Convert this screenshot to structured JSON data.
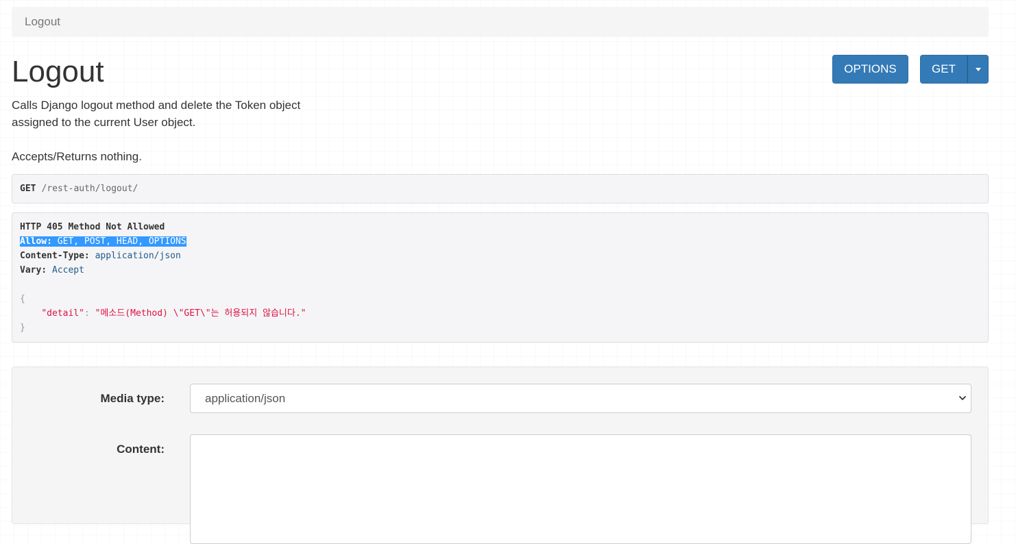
{
  "breadcrumb": {
    "active": "Logout"
  },
  "page": {
    "title": "Logout",
    "description_line1": "Calls Django logout method and delete the Token object",
    "description_line2": "assigned to the current User object.",
    "description_line3": "Accepts/Returns nothing."
  },
  "buttons": {
    "options": "OPTIONS",
    "get": "GET"
  },
  "request": {
    "method": "GET",
    "path": "/rest-auth/logout/"
  },
  "response": {
    "status": "HTTP 405 Method Not Allowed",
    "headers": [
      {
        "name": "Allow:",
        "value": "GET, POST, HEAD, OPTIONS"
      },
      {
        "name": "Content-Type:",
        "value": "application/json"
      },
      {
        "name": "Vary:",
        "value": "Accept"
      }
    ],
    "body": {
      "open_brace": "{",
      "key": "\"detail\"",
      "colon": ":",
      "value": "\"메소드(Method) \\\"GET\\\"는 허용되지 않습니다.\"",
      "close_brace": "}"
    }
  },
  "form": {
    "media_type_label": "Media type:",
    "media_type_value": "application/json",
    "content_label": "Content:",
    "content_value": ""
  },
  "icons": {
    "caret": "caret-down-icon",
    "select_chevron": "chevron-down-icon"
  },
  "colors": {
    "primary": "#337ab7",
    "selection": "#3399ff",
    "json_string": "#dd1144",
    "header_value": "#1f5a8a"
  }
}
